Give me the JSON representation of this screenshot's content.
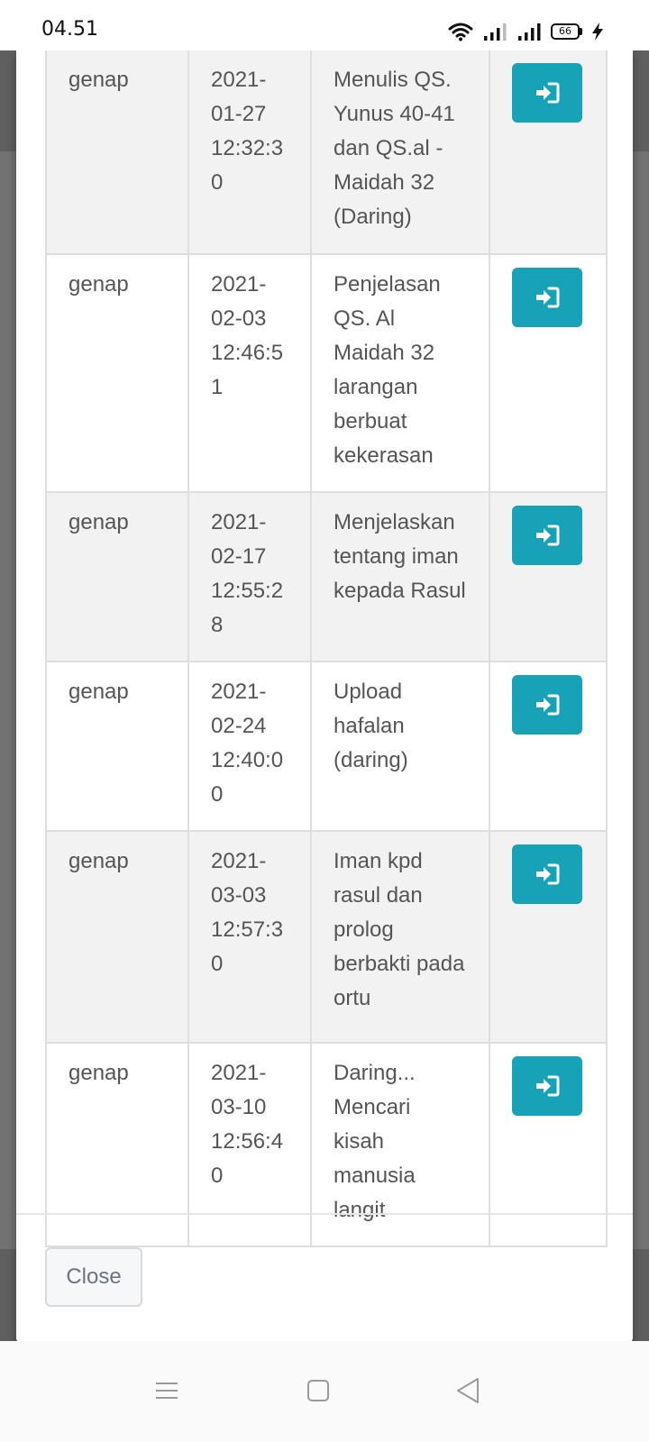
{
  "status_bar": {
    "time": "04.51",
    "battery_level": "66",
    "icons": [
      "wifi-icon",
      "signal-icon",
      "signal-icon",
      "battery-icon",
      "charging-icon"
    ]
  },
  "table": {
    "rows": [
      {
        "semester": "genap",
        "datetime": "2021-\n01-27\n12:32:30",
        "description": "Menulis QS. Yunus 40-41 dan QS.al -Maidah 32 (Daring)",
        "action_icon": "sign-in-icon"
      },
      {
        "semester": "genap",
        "datetime": "2021-\n02-03\n12:46:51",
        "description": "Penjelasan QS. Al Maidah 32 larangan berbuat kekerasan",
        "action_icon": "sign-in-icon"
      },
      {
        "semester": "genap",
        "datetime": "2021-\n02-17\n12:55:28",
        "description": "Menjelaskan tentang iman kepada Rasul",
        "action_icon": "sign-in-icon"
      },
      {
        "semester": "genap",
        "datetime": "2021-\n02-24\n12:40:00",
        "description": "Upload hafalan (daring)",
        "action_icon": "sign-in-icon"
      },
      {
        "semester": "genap",
        "datetime": "2021-\n03-03\n12:57:30",
        "description": "Iman kpd rasul dan prolog berbakti pada ortu",
        "action_icon": "sign-in-icon"
      },
      {
        "semester": "genap",
        "datetime": "2021-\n03-10\n12:56:40",
        "description": "Daring... Mencari kisah manusia langit",
        "action_icon": "sign-in-icon"
      }
    ]
  },
  "footer": {
    "close_label": "Close"
  },
  "nav_bar": {
    "icons": [
      "menu-icon",
      "home-icon",
      "back-icon"
    ]
  },
  "colors": {
    "action_button": "#17a2b8",
    "row_striped": "#f2f2f2",
    "backdrop": "#727272"
  }
}
